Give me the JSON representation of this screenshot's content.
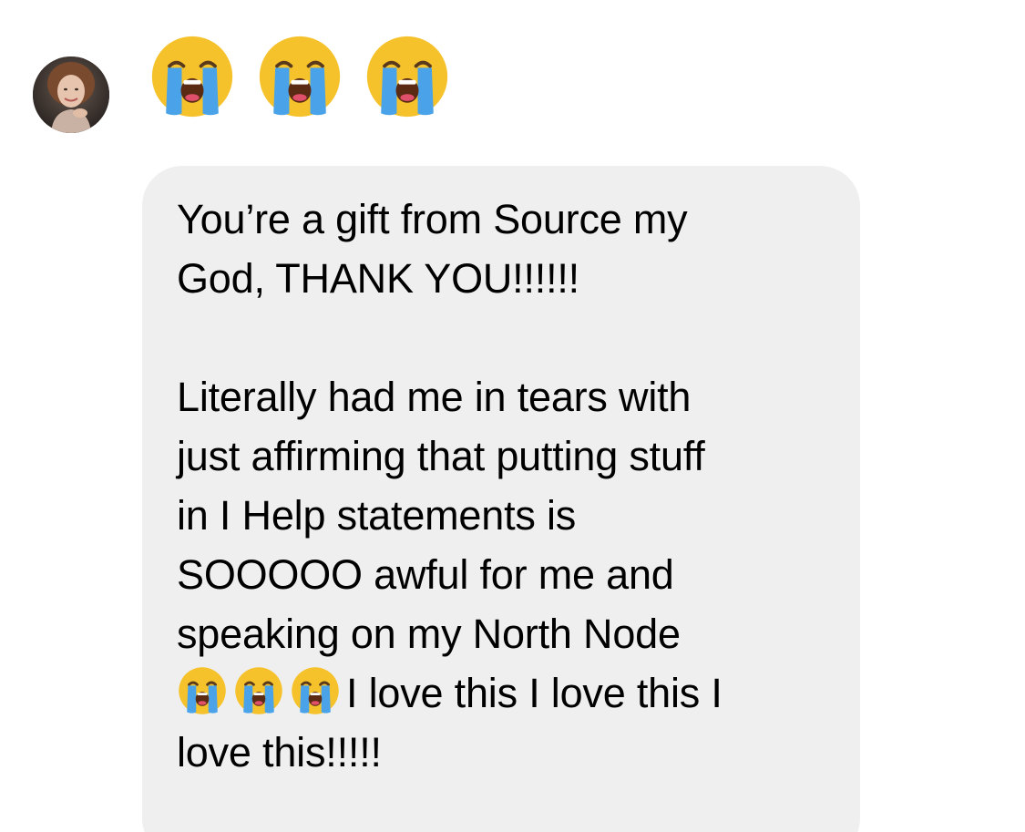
{
  "conversation": {
    "sender_avatar": "avatar",
    "reaction": {
      "emojis": [
        "loudly-crying-face-icon",
        "loudly-crying-face-icon",
        "loudly-crying-face-icon"
      ]
    },
    "message": {
      "line1": "You’re a gift from Source my",
      "line2": "God, THANK YOU!!!!!!",
      "line3": "Literally had me in tears with",
      "line4": "just affirming that putting stuff",
      "line5": "in I Help statements is",
      "line6": "SOOOOO awful for me and",
      "line7": "speaking on my North Node",
      "line8_text": "I love this I love this I",
      "line9": "love this!!!!!",
      "inline_emojis": [
        "loudly-crying-face-icon",
        "loudly-crying-face-icon",
        "loudly-crying-face-icon"
      ]
    }
  },
  "colors": {
    "bubble_background": "#efeff0",
    "text": "#000000",
    "emoji_face": "#f6c22c",
    "emoji_tears": "#4aa3e8"
  }
}
